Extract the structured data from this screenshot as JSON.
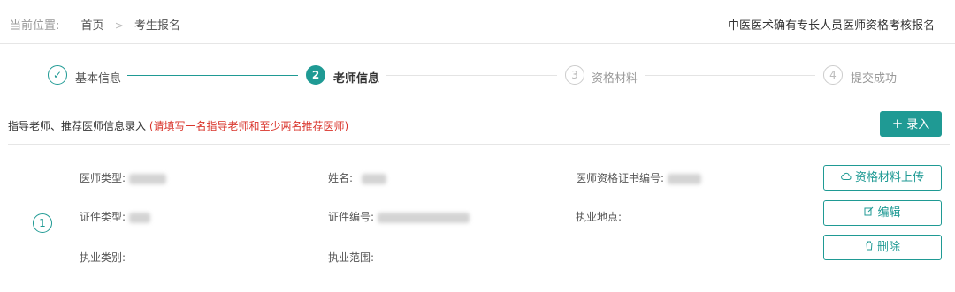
{
  "breadcrumb": {
    "lead": "当前位置:",
    "home": "首页",
    "sep": ">",
    "current": "考生报名"
  },
  "page_title": "中医医术确有专长人员医师资格考核报名",
  "steps": [
    {
      "num": "✓",
      "label": "基本信息",
      "status": "done"
    },
    {
      "num": "2",
      "label": "老师信息",
      "status": "active"
    },
    {
      "num": "3",
      "label": "资格材料",
      "status": "todo"
    },
    {
      "num": "4",
      "label": "提交成功",
      "status": "todo"
    }
  ],
  "section": {
    "title": "指导老师、推荐医师信息录入",
    "note": "(请填写一名指导老师和至少两名推荐医师)",
    "add_label": "录入",
    "add_icon": "plus-icon"
  },
  "record": {
    "index": "1",
    "fields": {
      "doctor_type": "医师类型:",
      "name": "姓名:",
      "cert_no": "医师资格证书编号:",
      "id_type": "证件类型:",
      "id_no": "证件编号:",
      "practice_place": "执业地点:",
      "practice_category": "执业类别:",
      "practice_scope": "执业范围:"
    },
    "actions": {
      "upload": "资格材料上传",
      "edit": "编辑",
      "delete": "删除"
    }
  },
  "colors": {
    "accent": "#1f9a94",
    "note_red": "#d9342b"
  }
}
